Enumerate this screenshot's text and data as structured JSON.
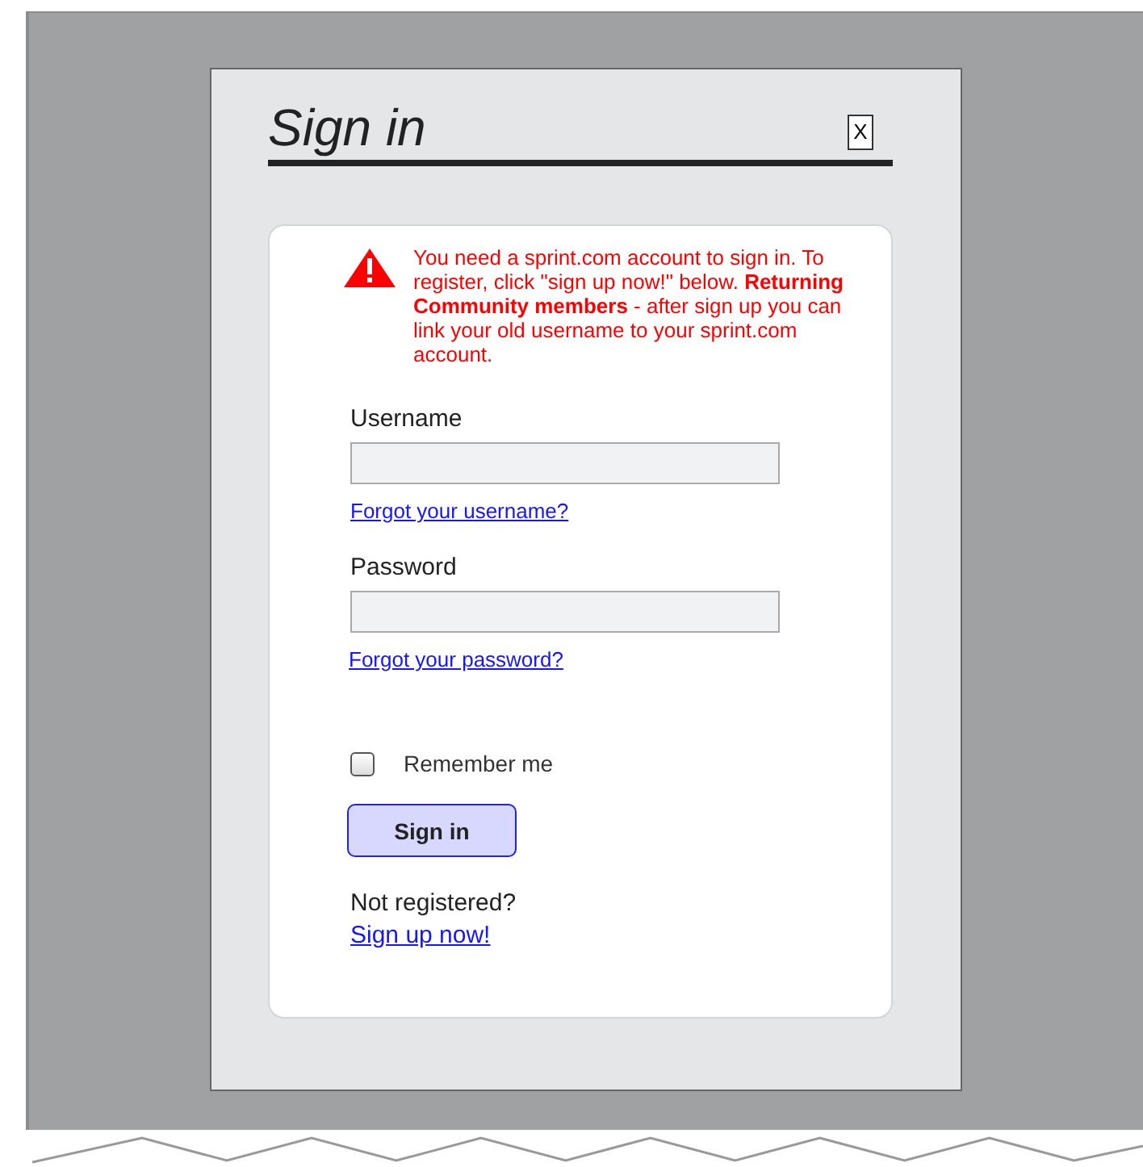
{
  "dialog": {
    "title": "Sign in",
    "close": "X"
  },
  "notice": {
    "kind": "warning",
    "text": "You need a sprint.com account to sign in. To register, click \"sign up now!\" below. **Returning Community members** - after sign up you can link your old username to your sprint.com account."
  },
  "fields": [
    {
      "label": "Username",
      "link": "Forgot your username?"
    },
    {
      "label": "Password",
      "link": "Forgot your password?"
    }
  ],
  "remember": {
    "label": "Remember me",
    "checked": false
  },
  "submit": "Sign in",
  "register": {
    "prompt": "Not registered?",
    "link": "Sign up now!"
  }
}
